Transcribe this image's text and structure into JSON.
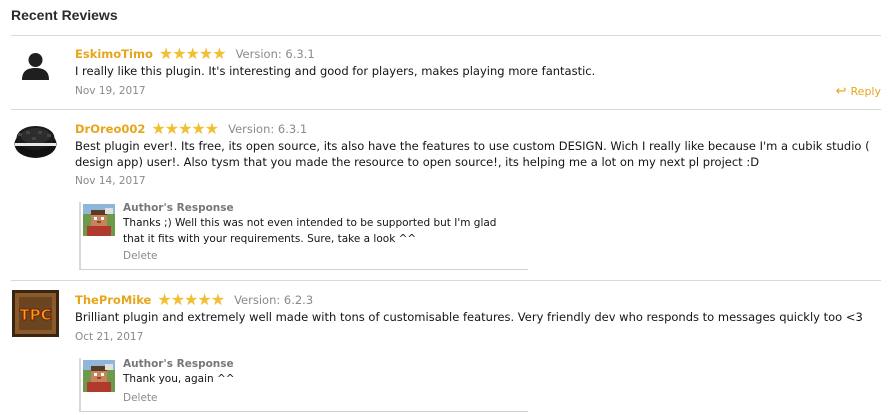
{
  "section": {
    "title": "Recent Reviews"
  },
  "reviews": [
    {
      "username": "EskimoTimo",
      "rating": 5,
      "version": "Version: 6.3.1",
      "text": "I really like this plugin. It's interesting and good for players, makes playing more fantastic.",
      "date": "Nov 19, 2017",
      "reply_label": "Reply"
    },
    {
      "username": "DrOreo002",
      "rating": 5,
      "version": "Version: 6.3.1",
      "text": "Best plugin ever!. Its free, its open source, its also have the features to use custom DESIGN. Wich I really like because I'm a cubik studio ( design app) user!. Also tysm that you made the resource to open source!, its helping me a lot on my next pl project :D",
      "date": "Nov 14, 2017",
      "response": {
        "label": "Author's Response",
        "text": "Thanks ;) Well this was not even intended to be supported but I'm glad that it fits with your requirements. Sure, take a look ^^",
        "delete_label": "Delete"
      }
    },
    {
      "username": "TheProMike",
      "rating": 5,
      "version": "Version: 6.2.3",
      "text": "Brilliant plugin and extremely well made with tons of customisable features. Very friendly dev who responds to messages quickly too <3",
      "date": "Oct 21, 2017",
      "avatar_text": "TPC",
      "response": {
        "label": "Author's Response",
        "text": "Thank you, again ^^",
        "delete_label": "Delete"
      }
    }
  ],
  "icons": {
    "star": "star-icon",
    "reply": "reply-icon",
    "default_avatar": "user-silhouette-icon"
  },
  "colors": {
    "accent": "#e6a51b",
    "star": "#f2bf32",
    "muted": "#8a8a8a",
    "divider": "#d8d8d8"
  }
}
